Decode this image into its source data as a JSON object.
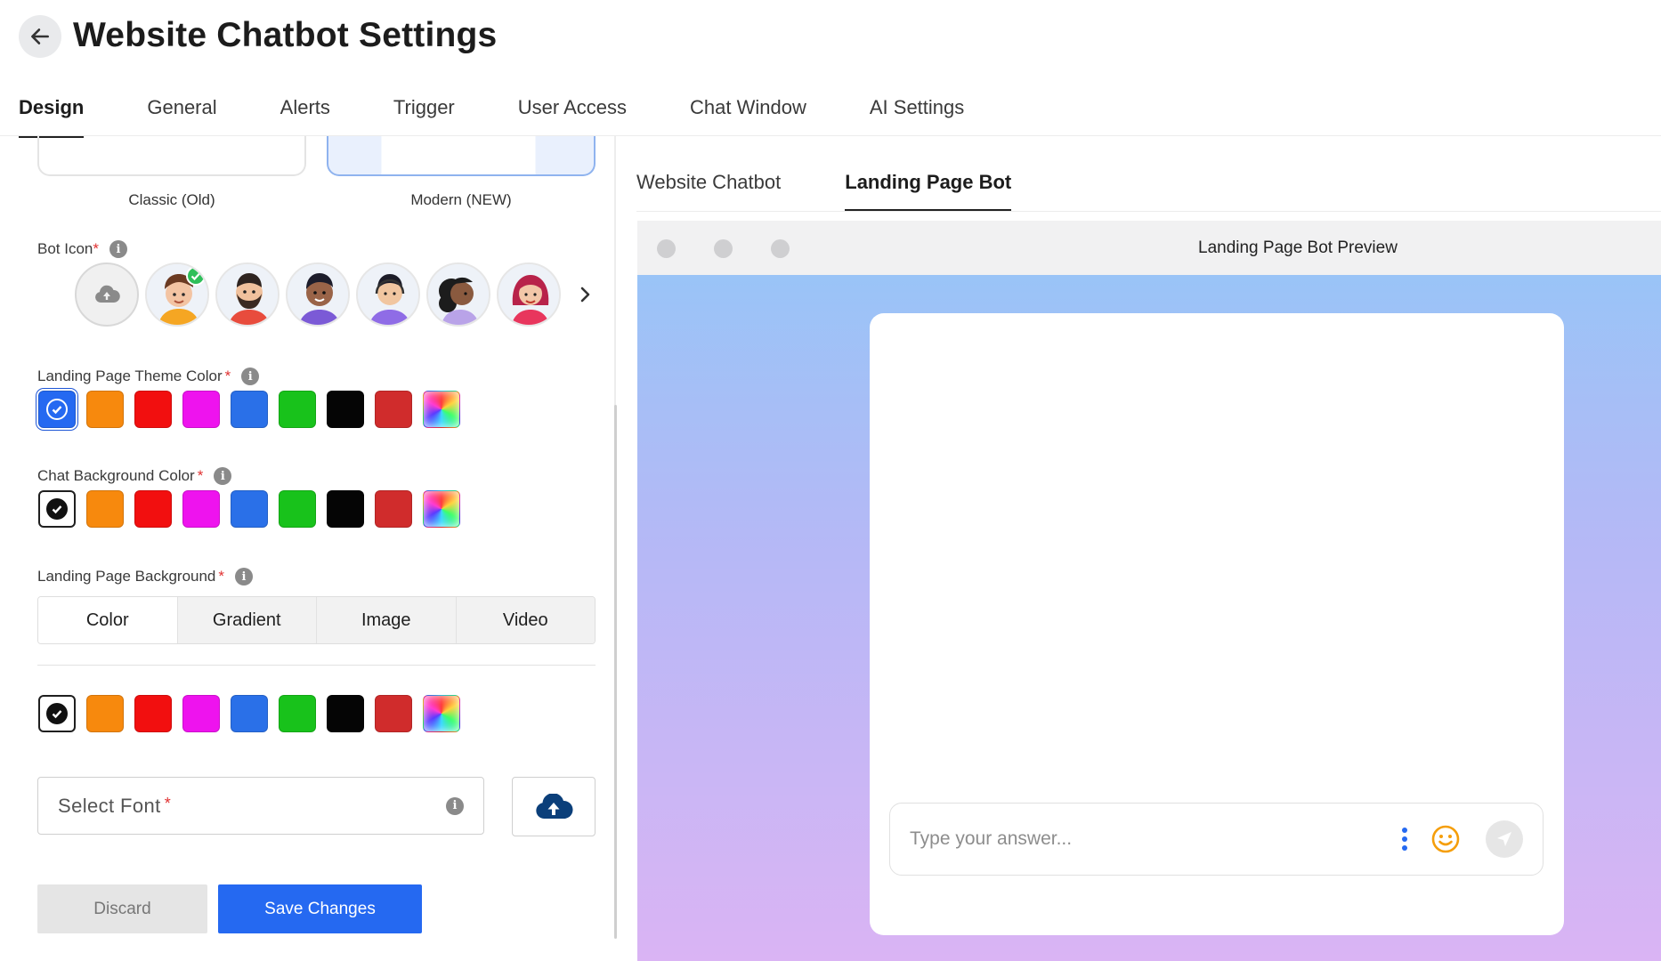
{
  "header": {
    "title": "Website Chatbot Settings"
  },
  "main_tabs": [
    {
      "label": "Design",
      "active": true
    },
    {
      "label": "General"
    },
    {
      "label": "Alerts"
    },
    {
      "label": "Trigger"
    },
    {
      "label": "User Access"
    },
    {
      "label": "Chat Window"
    },
    {
      "label": "AI Settings"
    }
  ],
  "design": {
    "styles": [
      {
        "label": "Classic (Old)"
      },
      {
        "label": "Modern (NEW)",
        "selected": true
      }
    ],
    "bot_icon": {
      "label": "Bot Icon",
      "required_mark": "*",
      "icons": [
        "upload-icon",
        "avatar-boy-orange-hoodie",
        "avatar-bearded-man",
        "avatar-man-purple-shirt",
        "avatar-man-headset",
        "avatar-woman-curly-hair",
        "avatar-woman-red-hair"
      ],
      "selected_index": 1
    },
    "theme_color": {
      "label": "Landing Page Theme Color",
      "required_mark": "*",
      "colors": [
        "#2569f1",
        "#f7890d",
        "#f20f0f",
        "#ee13ee",
        "#2a70e8",
        "#18c21b",
        "#050505",
        "#d02c2c",
        "rainbow"
      ],
      "selected_index": 0
    },
    "chat_background": {
      "label": "Chat Background Color",
      "required_mark": "*",
      "colors": [
        "#ffffff",
        "#f7890d",
        "#f20f0f",
        "#ee13ee",
        "#2a70e8",
        "#18c21b",
        "#050505",
        "#d02c2c",
        "rainbow"
      ],
      "selected_index": 0
    },
    "landing_background": {
      "label": "Landing Page Background",
      "required_mark": "*",
      "options": [
        "Color",
        "Gradient",
        "Image",
        "Video"
      ],
      "active_option": "Gradient",
      "colors": [
        "#ffffff",
        "#f7890d",
        "#f20f0f",
        "#ee13ee",
        "#2a70e8",
        "#18c21b",
        "#050505",
        "#d02c2c",
        "rainbow"
      ],
      "selected_index": 0
    },
    "font": {
      "placeholder": "Select Font",
      "required_mark": "*"
    },
    "buttons": {
      "discard": "Discard",
      "save": "Save Changes"
    }
  },
  "preview": {
    "tabs": [
      {
        "label": "Website Chatbot"
      },
      {
        "label": "Landing Page Bot",
        "active": true
      }
    ],
    "window_title": "Landing Page Bot Preview",
    "input_placeholder": "Type your answer...",
    "gradient": [
      "#94c6f7",
      "#b6b8f6",
      "#dab4f4"
    ]
  }
}
